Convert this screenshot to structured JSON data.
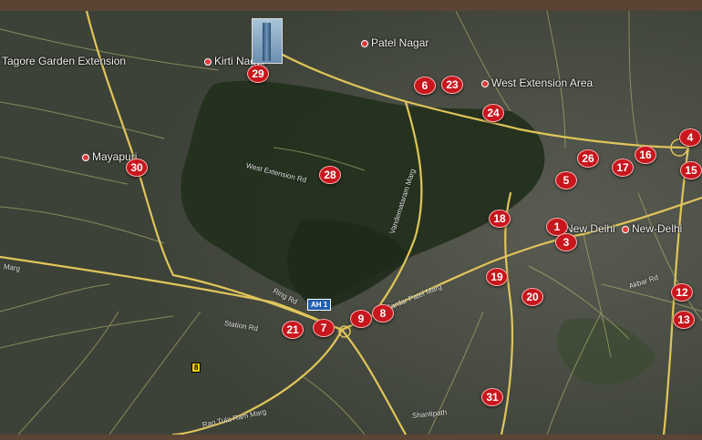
{
  "map": {
    "colors": {
      "frame": "#5a4535",
      "terrain": "#3d4238",
      "park": "#27331f",
      "major_road": "#e0c55a",
      "minor_road": "#c9c27a",
      "marker": "#c8161d"
    },
    "places": [
      {
        "id": "patel-nagar",
        "name": "Patel Nagar",
        "pin": true
      },
      {
        "id": "tagore-garden-extension",
        "name": "Tagore Garden Extension",
        "pin": false
      },
      {
        "id": "kirti-nagar",
        "name": "Kirti Nagar",
        "pin": true
      },
      {
        "id": "west-extension-area",
        "name": "West Extension Area",
        "pin": true
      },
      {
        "id": "mayapuri",
        "name": "Mayapuri",
        "pin": true
      },
      {
        "id": "new-delhi-1",
        "name": "New Delhi",
        "pin": false
      },
      {
        "id": "new-delhi-2",
        "name": "New-Delhi",
        "pin": true
      }
    ],
    "roads": [
      {
        "id": "ring-rd",
        "name": "Ring Rd"
      },
      {
        "id": "station-rd",
        "name": "Station Rd"
      },
      {
        "id": "sardar-patel-marg",
        "name": "Sardar Patel Marg"
      },
      {
        "id": "vandemataram-marg",
        "name": "Vandemataram Marg"
      },
      {
        "id": "akbar-rd",
        "name": "Akbar Rd"
      },
      {
        "id": "shantipath",
        "name": "Shantipath"
      },
      {
        "id": "rao-tula-ram-marg",
        "name": "Rao Tula Ram Marg"
      },
      {
        "id": "marg",
        "name": "Marg"
      },
      {
        "id": "west-extension-rd",
        "name": "West Extension Rd"
      }
    ],
    "shields": [
      {
        "id": "ah1",
        "label": "AH 1"
      },
      {
        "id": "nh8",
        "label": "8"
      }
    ],
    "markers": [
      "29",
      "6",
      "23",
      "24",
      "4",
      "26",
      "16",
      "17",
      "15",
      "5",
      "30",
      "28",
      "18",
      "1",
      "3",
      "19",
      "20",
      "12",
      "13",
      "9",
      "8",
      "7",
      "21",
      "31"
    ]
  }
}
